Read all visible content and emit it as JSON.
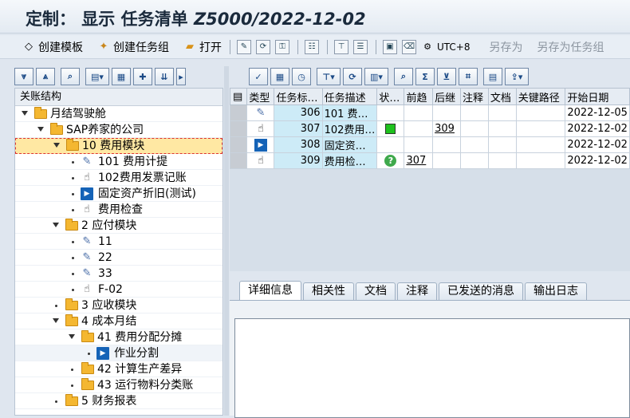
{
  "title": {
    "prefix": "定制：  显示 任务清单",
    "code": "Z5000/2022-12-02"
  },
  "appbar": {
    "items": [
      {
        "label": "创建模板",
        "icon": "template-icon"
      },
      {
        "label": "创建任务组",
        "icon": "task-group-icon"
      },
      {
        "label": "打开",
        "icon": "folder-open-icon"
      }
    ],
    "utc": "UTC+8",
    "save_as": "另存为",
    "save_as_task": "另存为任务组"
  },
  "tree": {
    "header": "关账结构",
    "rows": [
      {
        "label": "月结驾驶舱"
      },
      {
        "label": "SAP养家的公司"
      },
      {
        "label": "10 费用模块"
      },
      {
        "label": "101 费用计提"
      },
      {
        "label": "102费用发票记账"
      },
      {
        "label": "固定资产折旧(测试)"
      },
      {
        "label": "费用检查"
      },
      {
        "label": "2 应付模块"
      },
      {
        "label": "11"
      },
      {
        "label": "22"
      },
      {
        "label": "33"
      },
      {
        "label": "F-02"
      },
      {
        "label": "3 应收模块"
      },
      {
        "label": "4 成本月结"
      },
      {
        "label": "41 费用分配分摊"
      },
      {
        "label": "作业分割"
      },
      {
        "label": "42 计算生产差异"
      },
      {
        "label": "43 运行物料分类账"
      },
      {
        "label": "5 财务报表"
      }
    ]
  },
  "grid": {
    "columns": [
      "类型",
      "任务标…",
      "任务描述",
      "状…",
      "前趋",
      "后继",
      "注释",
      "文档",
      "关键路径",
      "开始日期"
    ],
    "rows": [
      {
        "id": "306",
        "desc": "101 费…",
        "pred": "",
        "succ": "",
        "start": "2022-12-05"
      },
      {
        "id": "307",
        "desc": "102费用…",
        "pred": "",
        "succ": "309",
        "start": "2022-12-02"
      },
      {
        "id": "308",
        "desc": "固定资…",
        "pred": "",
        "succ": "",
        "start": "2022-12-02"
      },
      {
        "id": "309",
        "desc": "费用检…",
        "pred": "307",
        "succ": "",
        "start": "2022-12-02"
      }
    ]
  },
  "tabs": [
    "详细信息",
    "相关性",
    "文档",
    "注释",
    "已发送的消息",
    "输出日志"
  ]
}
